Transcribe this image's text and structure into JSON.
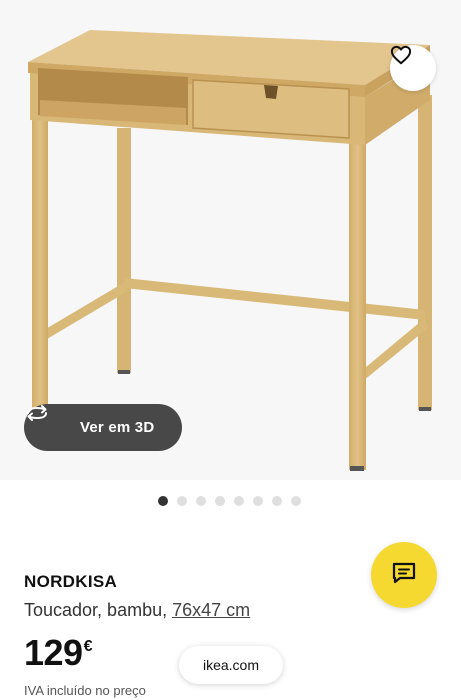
{
  "product": {
    "name": "NORDKISA",
    "description": "Toucador, bambu,",
    "dimensions": "76x47 cm",
    "price": "129",
    "currency": "€",
    "vat_note": "IVA incluído no preço"
  },
  "gallery": {
    "view_3d_label": "Ver em 3D",
    "image_count": 8,
    "active_index": 0
  },
  "browser": {
    "url": "ikea.com"
  },
  "icons": {
    "favorite": "heart-icon",
    "rotate_3d": "rotate-3d-icon",
    "chat": "chat-bubble-icon"
  },
  "colors": {
    "chat_button": "#f5d930",
    "view3d_button": "#484848",
    "dot_active": "#333333",
    "dot_inactive": "#dfdfdf",
    "bamboo": "#d9b978"
  }
}
